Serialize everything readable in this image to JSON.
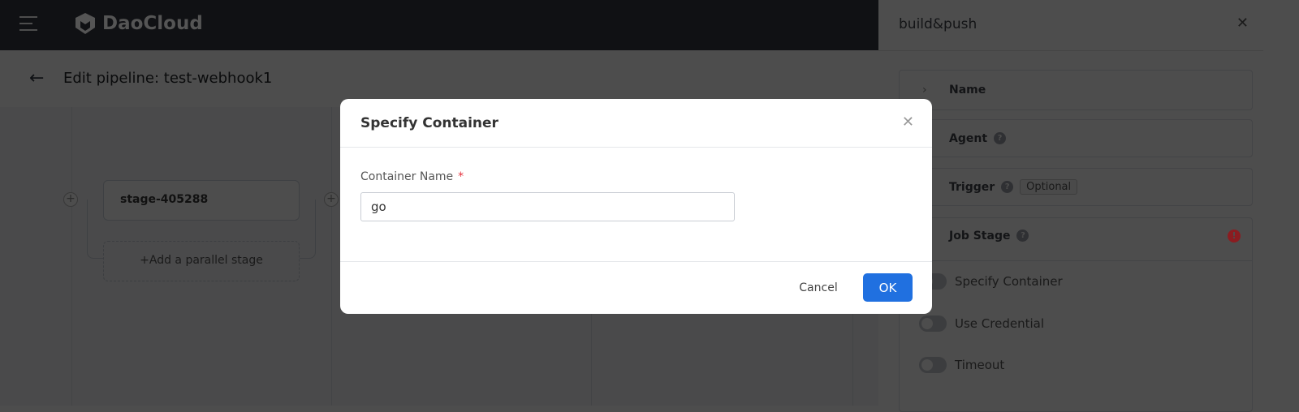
{
  "topbar": {
    "brand": "DaoCloud",
    "menu_icon": "hamburger-icon"
  },
  "page": {
    "title": "Edit pipeline: test-webhook1"
  },
  "canvas": {
    "stage_name": "stage-405288",
    "add_parallel": "+Add a parallel stage"
  },
  "drawer": {
    "title": "build&push",
    "sections": [
      {
        "label": "Name"
      },
      {
        "label": "Agent"
      },
      {
        "label": "Trigger",
        "tag": "Optional"
      },
      {
        "label": "Job Stage"
      }
    ],
    "toggles": [
      {
        "label": "Specify Container",
        "on": false
      },
      {
        "label": "Use Credential",
        "on": false
      },
      {
        "label": "Timeout",
        "on": false
      }
    ],
    "error_color": "#c0282d"
  },
  "modal": {
    "title": "Specify Container",
    "field_label": "Container Name",
    "required_mark": "*",
    "field_value": "go",
    "cancel": "Cancel",
    "ok": "OK",
    "accent": "#2070e0"
  }
}
